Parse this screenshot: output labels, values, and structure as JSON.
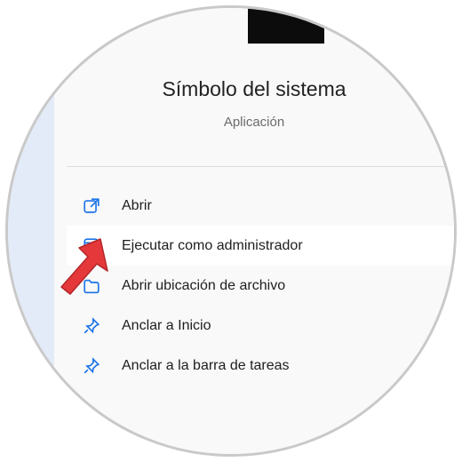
{
  "app": {
    "title": "Símbolo del sistema",
    "subtitle": "Aplicación"
  },
  "menu": {
    "items": [
      {
        "label": "Abrir",
        "icon": "open-external-icon"
      },
      {
        "label": "Ejecutar como administrador",
        "icon": "shield-admin-icon"
      },
      {
        "label": "Abrir ubicación de archivo",
        "icon": "folder-icon"
      },
      {
        "label": "Anclar a Inicio",
        "icon": "pin-icon"
      },
      {
        "label": "Anclar a la barra de tareas",
        "icon": "pin-icon"
      }
    ]
  },
  "colors": {
    "accent": "#1a73e8",
    "annotation_arrow": "#e5383b",
    "highlight_row": "#ffffff"
  }
}
